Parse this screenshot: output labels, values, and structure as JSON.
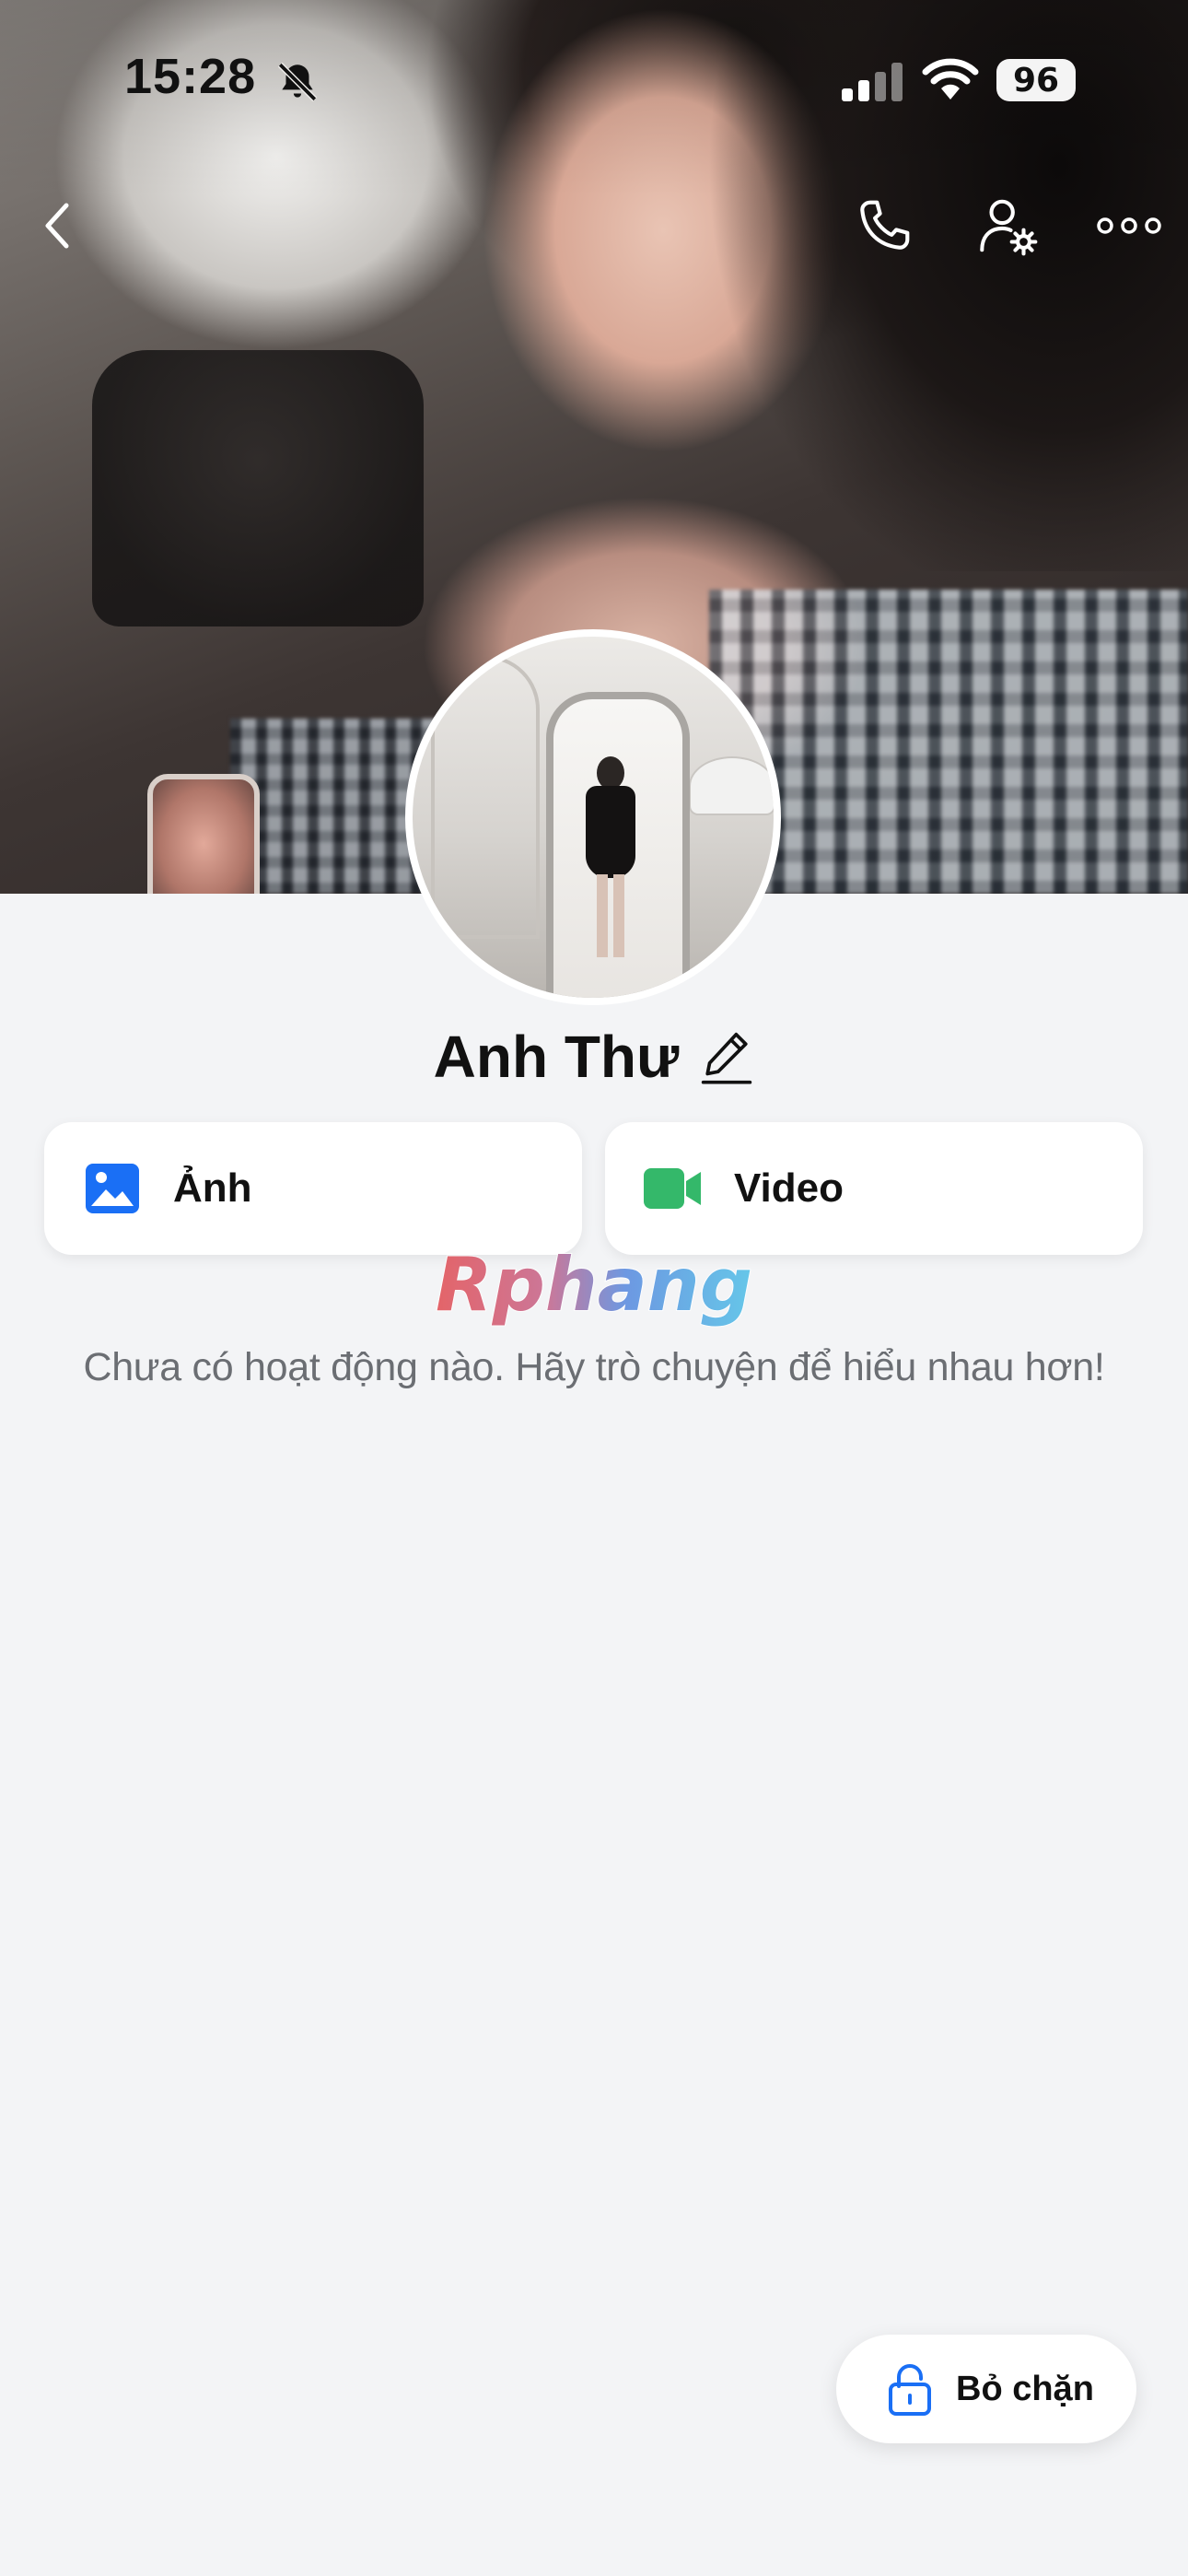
{
  "status_bar": {
    "time": "15:28",
    "battery_level": "96",
    "notifications_muted": true,
    "signal_bars_active": 2,
    "signal_bars_total": 4
  },
  "header": {
    "back_icon": "chevron-left-icon",
    "call_icon": "phone-icon",
    "settings_icon": "user-gear-icon",
    "more_icon": "ellipsis-icon"
  },
  "profile": {
    "name": "Anh Thư",
    "edit_icon": "pencil-icon"
  },
  "media_buttons": {
    "photos_label": "Ảnh",
    "photos_icon": "image-icon",
    "photos_color": "#1a6ff5",
    "video_label": "Video",
    "video_icon": "video-camera-icon",
    "video_color": "#34b86a"
  },
  "watermark": {
    "text": "Rphang"
  },
  "empty_state": {
    "message": "Chưa có hoạt động nào. Hãy trò chuyện để hiểu nhau hơn!"
  },
  "actions": {
    "unblock_label": "Bỏ chặn",
    "unblock_icon": "unlock-icon",
    "unblock_icon_color": "#1a6ff5"
  },
  "colors": {
    "background": "#f3f4f6",
    "card": "#ffffff",
    "text_primary": "#111111",
    "text_secondary": "#6b6e73"
  }
}
